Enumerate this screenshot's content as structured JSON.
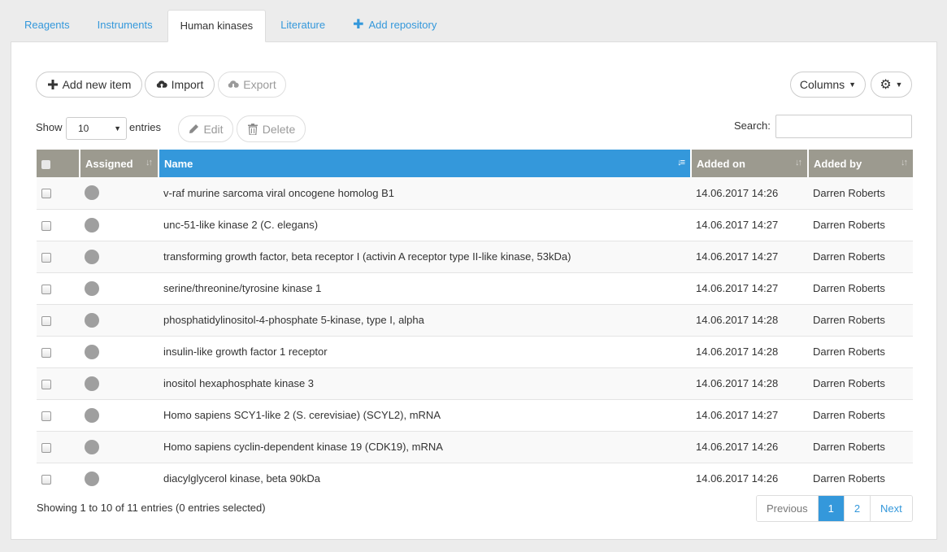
{
  "tabs": [
    {
      "label": "Reagents"
    },
    {
      "label": "Instruments"
    },
    {
      "label": "Human kinases",
      "active": true
    },
    {
      "label": "Literature"
    },
    {
      "label": "Add repository",
      "icon": "plus-icon"
    }
  ],
  "toolbar": {
    "add_label": "Add new item",
    "import_label": "Import",
    "export_label": "Export",
    "columns_label": "Columns",
    "edit_label": "Edit",
    "delete_label": "Delete"
  },
  "length": {
    "show_label": "Show",
    "value": "10",
    "entries_label": "entries"
  },
  "search": {
    "label": "Search:",
    "value": ""
  },
  "table": {
    "headers": [
      "Assigned",
      "Name",
      "Added on",
      "Added by"
    ],
    "rows": [
      {
        "name": "v-raf murine sarcoma viral oncogene homolog B1",
        "added_on": "14.06.2017 14:26",
        "added_by": "Darren Roberts"
      },
      {
        "name": "unc-51-like kinase 2 (C. elegans)",
        "added_on": "14.06.2017 14:27",
        "added_by": "Darren Roberts"
      },
      {
        "name": "transforming growth factor, beta receptor I (activin A receptor type II-like kinase, 53kDa)",
        "added_on": "14.06.2017 14:27",
        "added_by": "Darren Roberts"
      },
      {
        "name": "serine/threonine/tyrosine kinase 1",
        "added_on": "14.06.2017 14:27",
        "added_by": "Darren Roberts"
      },
      {
        "name": "phosphatidylinositol-4-phosphate 5-kinase, type I, alpha",
        "added_on": "14.06.2017 14:28",
        "added_by": "Darren Roberts"
      },
      {
        "name": "insulin-like growth factor 1 receptor",
        "added_on": "14.06.2017 14:28",
        "added_by": "Darren Roberts"
      },
      {
        "name": "inositol hexaphosphate kinase 3",
        "added_on": "14.06.2017 14:28",
        "added_by": "Darren Roberts"
      },
      {
        "name": "Homo sapiens SCY1-like 2 (S. cerevisiae) (SCYL2), mRNA",
        "added_on": "14.06.2017 14:27",
        "added_by": "Darren Roberts"
      },
      {
        "name": "Homo sapiens cyclin-dependent kinase 19 (CDK19), mRNA",
        "added_on": "14.06.2017 14:26",
        "added_by": "Darren Roberts"
      },
      {
        "name": "diacylglycerol kinase, beta 90kDa",
        "added_on": "14.06.2017 14:26",
        "added_by": "Darren Roberts"
      }
    ]
  },
  "footer": {
    "info": "Showing 1 to 10 of 11 entries (0 entries selected)"
  },
  "pagination": {
    "previous": "Previous",
    "pages": [
      "1",
      "2"
    ],
    "current": "1",
    "next": "Next"
  },
  "colors": {
    "accent": "#3498db",
    "header_bg": "#9c9a8f"
  }
}
